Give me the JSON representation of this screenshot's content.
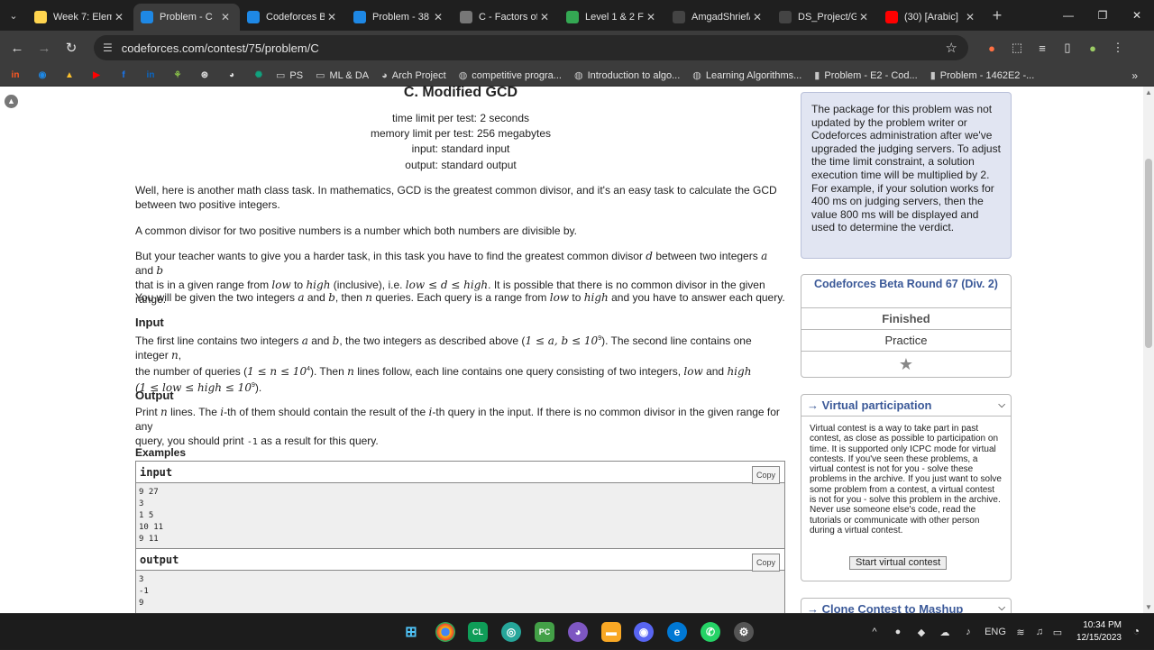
{
  "tabs": [
    {
      "title": "Week 7: Elem",
      "favicon": "coursera",
      "color": "#ffd54f"
    },
    {
      "title": "Problem - C",
      "favicon": "codeforces",
      "color": "#1e88e5",
      "active": true
    },
    {
      "title": "Codeforces B",
      "favicon": "codeforces",
      "color": "#1e88e5"
    },
    {
      "title": "Problem - 38",
      "favicon": "codeforces",
      "color": "#1e88e5"
    },
    {
      "title": "C - Factors of",
      "favicon": "atcoder",
      "color": "#777"
    },
    {
      "title": "Level 1 & 2 F",
      "favicon": "sheets",
      "color": "#34a853"
    },
    {
      "title": "AmgadShrief/",
      "favicon": "github",
      "color": "#444"
    },
    {
      "title": "DS_Project/G",
      "favicon": "github",
      "color": "#444"
    },
    {
      "title": "(30) [Arabic]",
      "favicon": "youtube",
      "color": "#ff0000"
    }
  ],
  "address": {
    "url": "codeforces.com/contest/75/problem/C"
  },
  "bookmarks": [
    {
      "label": "PS",
      "icon": "folder"
    },
    {
      "label": "ML & DA",
      "icon": "folder"
    },
    {
      "label": "Arch Project",
      "icon": "github"
    },
    {
      "label": "competitive progra...",
      "icon": "globe"
    },
    {
      "label": "Introduction to algo...",
      "icon": "globe"
    },
    {
      "label": "Learning Algorithms...",
      "icon": "globe"
    },
    {
      "label": "Problem - E2 - Cod...",
      "icon": "codeforces"
    },
    {
      "label": "Problem - 1462E2 -...",
      "icon": "codeforces"
    }
  ],
  "problem": {
    "title": "C. Modified GCD",
    "time_limit": "time limit per test: 2 seconds",
    "memory_limit": "memory limit per test: 256 megabytes",
    "input": "input: standard input",
    "output": "output: standard output",
    "p1": "Well, here is another math class task. In mathematics, GCD is the greatest common divisor, and it's an easy task to calculate the GCD between two positive integers.",
    "p2": "A common divisor for two positive numbers is a number which both numbers are divisible by.",
    "p3a": "But your teacher wants to give you a harder task, in this task you have to find the greatest common divisor ",
    "p3b": " between two integers ",
    "p3c": " and ",
    "p3d": "that is in a given range from ",
    "p3e": " to ",
    "p3f": " (inclusive), i.e. ",
    "p3g": ". It is possible that there is no common divisor in the given range.",
    "p4a": "You will be given the two integers ",
    "p4b": " and ",
    "p4c": ", then ",
    "p4d": " queries. Each query is a range from ",
    "p4e": " to ",
    "p4f": " and you have to answer each query.",
    "input_title": "Input",
    "in1a": "The first line contains two integers ",
    "in1b": " and ",
    "in1c": ", the two integers as described above (",
    "in1d": "). The second line contains one integer ",
    "in2a": "the number of queries (",
    "in2b": "). Then ",
    "in2c": " lines follow, each line contains one query consisting of two integers, ",
    "in2d": " and ",
    "output_title": "Output",
    "out1a": "Print ",
    "out1b": " lines. The ",
    "out1c": "-th of them should contain the result of the ",
    "out1d": "-th query in the input. If there is no common divisor in the given range for any",
    "out2a": "query, you should print ",
    "out2b": " as a result for this query.",
    "examples_title": "Examples",
    "sample_input_label": "input",
    "sample_output_label": "output",
    "copy_label": "Copy",
    "sample_input": [
      "9 27",
      "3",
      "1 5",
      "10 11",
      "9 11"
    ],
    "sample_output": [
      "3",
      "-1",
      "9"
    ]
  },
  "math": {
    "d": "d",
    "a": "a",
    "b": "b",
    "n": "n",
    "i": "i",
    "low": "low",
    "high": "high",
    "ineq1": "low ≤ d ≤ high",
    "ab_bound": "1 ≤ a, b ≤ 10",
    "ab_exp": "9",
    "n_bound": "1 ≤ n ≤ 10",
    "n_exp": "4",
    "lh_bound": "(1 ≤ low ≤ high ≤ 10",
    "lh_exp": "9",
    "neg": "-1",
    "comma": ",",
    "close": ")."
  },
  "sidebar": {
    "notice": "The package for this problem was not updated by the problem writer or Codeforces administration after we've upgraded the judging servers. To adjust the time limit constraint, a solution execution time will be multiplied by 2. For example, if your solution works for 400 ms on judging servers, then the value 800 ms will be displayed and used to determine the verdict.",
    "contest_name": "Codeforces Beta Round 67 (Div. 2)",
    "status": "Finished",
    "practice": "Practice",
    "vp_title": "→ Virtual participation",
    "vp_text": "Virtual contest is a way to take part in past contest, as close as possible to participation on time. It is supported only ICPC mode for virtual contests. If you've seen these problems, a virtual contest is not for you - solve these problems in the archive. If you just want to solve some problem from a contest, a virtual contest is not for you - solve this problem in the archive. Never use someone else's code, read the tutorials or communicate with other person during a virtual contest.",
    "vp_button": "Start virtual contest",
    "clone_title": "→ Clone Contest to Mashup"
  },
  "taskbar": {
    "lang": "ENG",
    "time": "10:34 PM",
    "date": "12/15/2023"
  }
}
